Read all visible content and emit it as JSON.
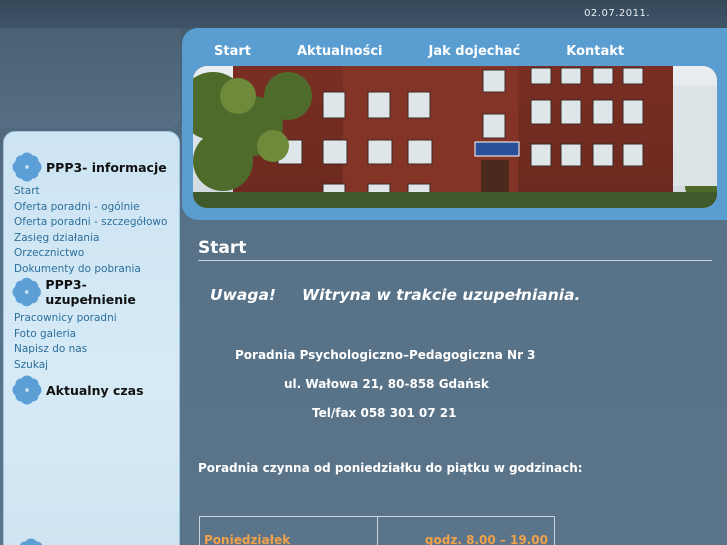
{
  "header": {
    "date": "02.07.2011.",
    "nav": [
      "Start",
      "Aktualności",
      "Jak dojechać",
      "Kontakt"
    ]
  },
  "sidebar": {
    "sections": [
      {
        "title": "PPP3- informacje",
        "items": [
          "Start",
          "Oferta poradni - ogólnie",
          "Oferta poradni - szczegółowo",
          "Zasięg działania",
          "Orzecznictwo",
          "Dokumenty do pobrania"
        ]
      },
      {
        "title": "PPP3- uzupełnienie",
        "items": [
          "Pracownicy poradni",
          "Foto galeria",
          "Napisz do nas",
          "Szukaj"
        ]
      },
      {
        "title": "Aktualny czas",
        "items": []
      }
    ],
    "flower_color": "#5b9fd6"
  },
  "main": {
    "title": "Start",
    "warning_label": "Uwaga!",
    "warning_text": "Witryna w trakcie uzupełniania.",
    "org_name": "Poradnia Psychologiczno–Pedagogiczna Nr 3",
    "address": "ul. Wałowa 21, 80-858 Gdańsk",
    "phone": "Tel/fax 058 301 07 21",
    "hours_intro": "Poradnia czynna od poniedziałku do piątku w godzinach:",
    "hours_table": [
      {
        "day": "Poniedziałek",
        "hours": "godz. 8.00 – 19.00"
      }
    ]
  }
}
